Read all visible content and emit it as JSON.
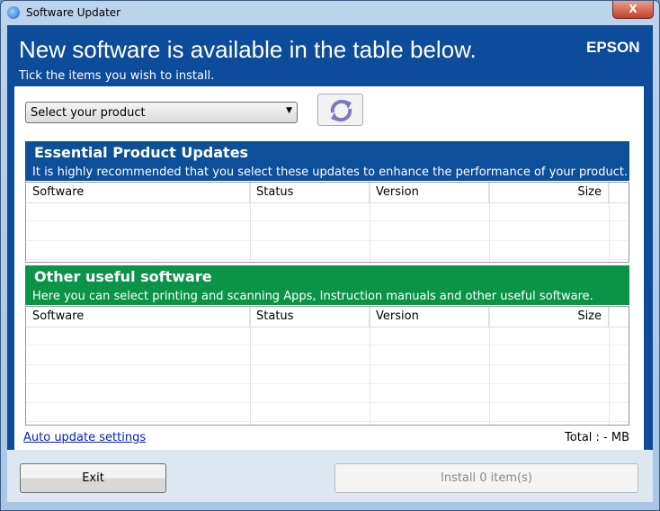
{
  "window": {
    "title": "Software Updater",
    "close": "X"
  },
  "header": {
    "title": "New software is available in the table below.",
    "subtitle": "Tick the items you wish to install.",
    "logo": "EPSON"
  },
  "product_select": {
    "value": "Select your product"
  },
  "essential": {
    "title": "Essential Product Updates",
    "description": "It is highly recommended that you select these updates to enhance the performance of your product.",
    "color": "#0e4f9a",
    "columns": [
      "Software",
      "Status",
      "Version",
      "Size"
    ]
  },
  "other": {
    "title": "Other useful software",
    "description": "Here you can select printing and scanning Apps, Instruction manuals and other useful software.",
    "color": "#0b9447",
    "columns": [
      "Software",
      "Status",
      "Version",
      "Size"
    ]
  },
  "footer": {
    "auto_update_link": "Auto update settings",
    "total": "Total :  - MB",
    "exit": "Exit",
    "install": "Install 0 item(s)"
  }
}
